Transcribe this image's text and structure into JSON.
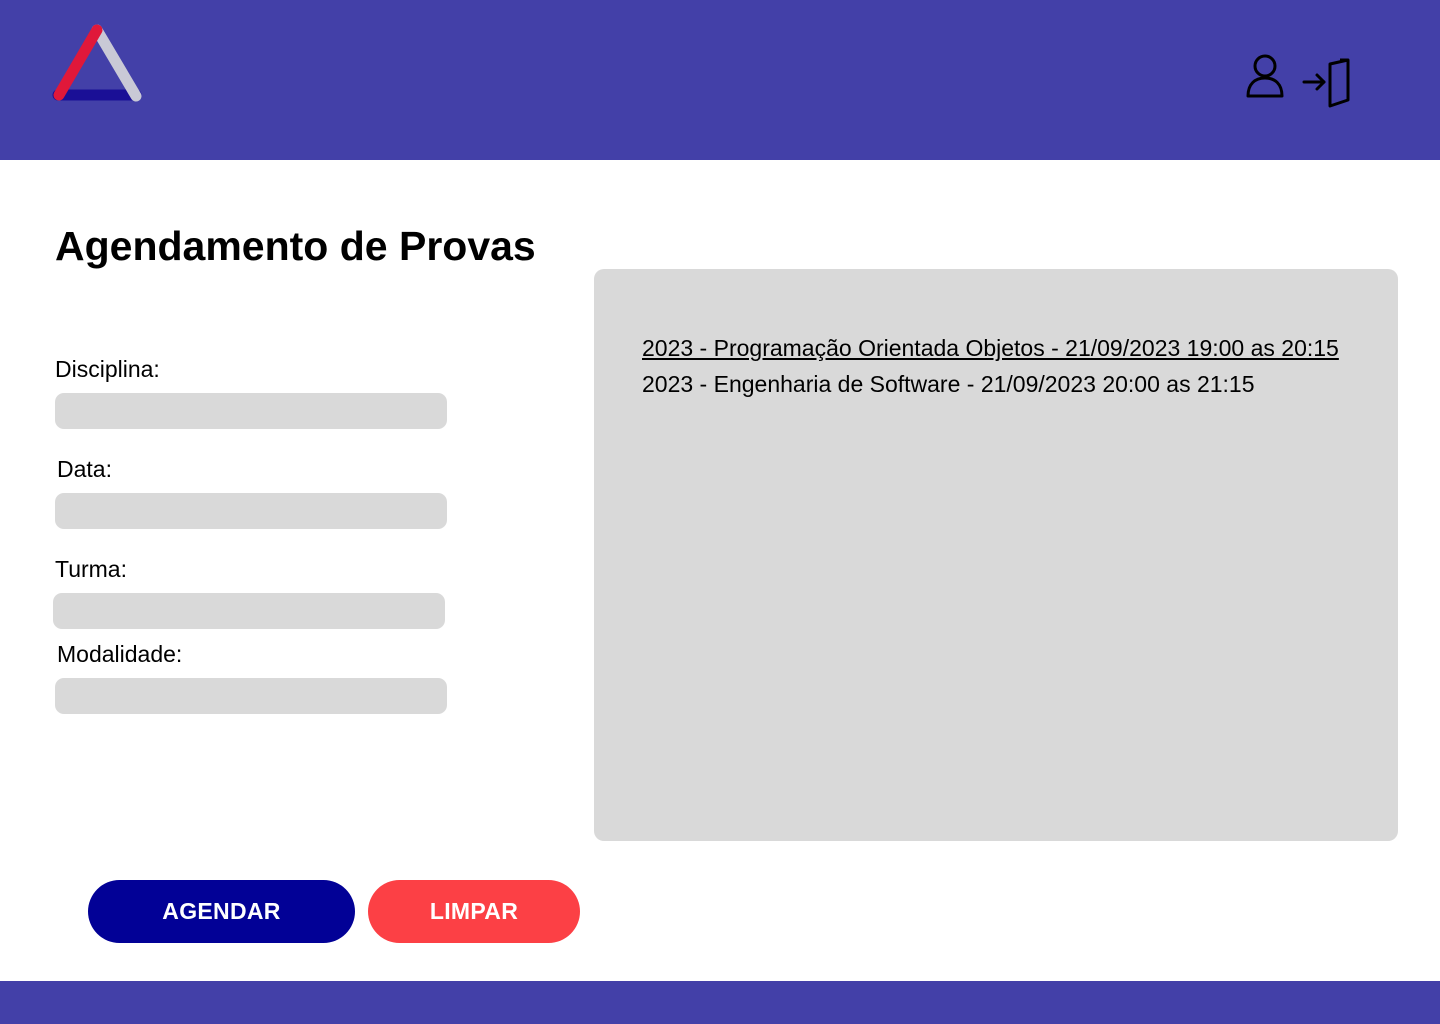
{
  "colors": {
    "header_bg": "#4340a8",
    "footer_bg": "#4340a8",
    "input_bg": "#d9d9d9",
    "panel_bg": "#d9d9d9",
    "primary_button": "#020196",
    "secondary_button": "#fc4045",
    "logo_red": "#e0183a",
    "logo_navy": "#1a0f96",
    "logo_light": "#c9c9d6"
  },
  "header": {
    "logo_icon": "triangle-logo",
    "user_icon": "user-icon",
    "logout_icon": "logout-icon"
  },
  "page": {
    "title": "Agendamento de Provas"
  },
  "form": {
    "disciplina": {
      "label": "Disciplina:",
      "value": ""
    },
    "data": {
      "label": "Data:",
      "value": ""
    },
    "turma": {
      "label": "Turma:",
      "value": ""
    },
    "modalidade": {
      "label": "Modalidade:",
      "value": ""
    }
  },
  "exams": {
    "items": [
      {
        "text": "2023 - Programação Orientada Objetos - 21/09/2023 19:00 as 20:15",
        "selected": true
      },
      {
        "text": "2023 - Engenharia de Software - 21/09/2023 20:00 as 21:15",
        "selected": false
      }
    ]
  },
  "buttons": {
    "agendar": "AGENDAR",
    "limpar": "LIMPAR"
  }
}
